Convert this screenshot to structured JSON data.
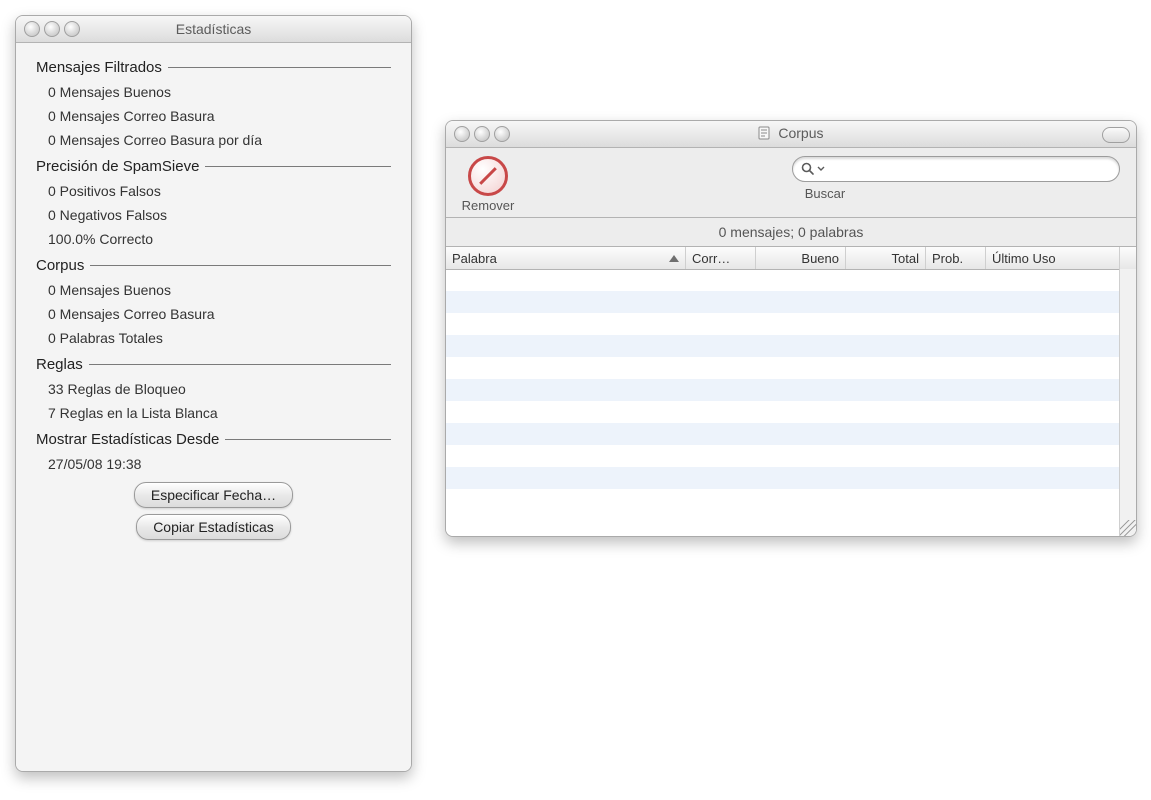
{
  "stats": {
    "title": "Estadísticas",
    "sections": {
      "filtered": {
        "title": "Mensajes Filtrados",
        "good": "0 Mensajes Buenos",
        "junk": "0 Mensajes Correo Basura",
        "junk_per_day": "0 Mensajes Correo Basura por día"
      },
      "precision": {
        "title": "Precisión de SpamSieve",
        "false_pos": "0 Positivos Falsos",
        "false_neg": "0 Negativos Falsos",
        "correct": "100.0% Correcto"
      },
      "corpus": {
        "title": "Corpus",
        "good": "0 Mensajes Buenos",
        "junk": "0 Mensajes Correo Basura",
        "words": "0 Palabras Totales"
      },
      "rules": {
        "title": "Reglas",
        "block": "33 Reglas de Bloqueo",
        "allow": "7 Reglas en la Lista Blanca"
      },
      "since": {
        "title": "Mostrar Estadísticas Desde",
        "date": "27/05/08 19:38"
      }
    },
    "buttons": {
      "specify_date": "Especificar Fecha…",
      "copy_stats": "Copiar Estadísticas"
    }
  },
  "corpus": {
    "title": "Corpus",
    "toolbar": {
      "remove_label": "Remover",
      "search_label": "Buscar",
      "search_placeholder": ""
    },
    "status": "0 mensajes; 0 palabras",
    "columns": {
      "word": "Palabra",
      "junk": "Corr…",
      "good": "Bueno",
      "total": "Total",
      "prob": "Prob.",
      "last": "Último Uso"
    }
  }
}
